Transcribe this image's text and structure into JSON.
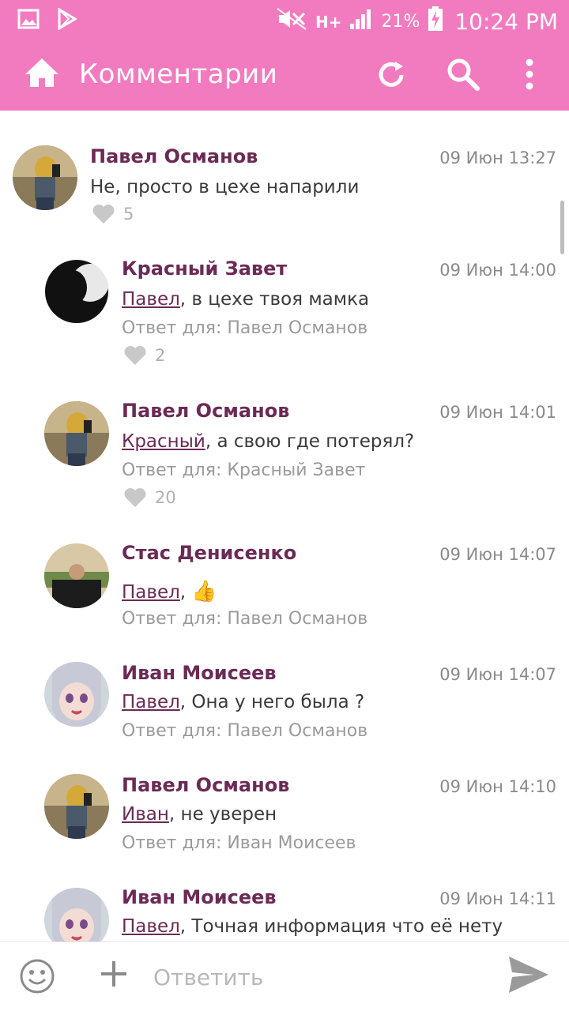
{
  "status_bar": {
    "network": "H+",
    "battery_percent": "21%",
    "time": "10:24 PM"
  },
  "app_bar": {
    "title": "Комментарии"
  },
  "comments": [
    {
      "author": "Павел Османов",
      "time": "09 Июн 13:27",
      "mention": "",
      "text": "Не, просто в цехе напарили",
      "reply_to": "",
      "likes": "5",
      "avatar": "selfie-mirror"
    },
    {
      "author": "Красный Завет",
      "time": "09 Июн 14:00",
      "mention": "Павел",
      "text": ", в цехе твоя мамка",
      "reply_to": "Ответ для: Павел Османов",
      "likes": "2",
      "avatar": "silhouette"
    },
    {
      "author": "Павел Османов",
      "time": "09 Июн 14:01",
      "mention": "Красный",
      "text": ", а свою где потерял?",
      "reply_to": "Ответ для: Красный Завет",
      "likes": "20",
      "avatar": "selfie-mirror"
    },
    {
      "author": "Стас Денисенко",
      "time": "09 Июн 14:07",
      "mention": "Павел",
      "text": ", ",
      "emoji": "👍",
      "reply_to": "Ответ для: Павел Османов",
      "likes": "",
      "avatar": "outdoor-man"
    },
    {
      "author": "Иван Моисеев",
      "time": "09 Июн 14:07",
      "mention": "Павел",
      "text": ",  Она у него была ?",
      "reply_to": "Ответ для: Павел Османов",
      "likes": "",
      "avatar": "anime-girl"
    },
    {
      "author": "Павел Османов",
      "time": "09 Июн 14:10",
      "mention": "Иван",
      "text": ", не уверен",
      "reply_to": "Ответ для: Иван Моисеев",
      "likes": "",
      "avatar": "selfie-mirror"
    },
    {
      "author": "Иван Моисеев",
      "time": "09 Июн 14:11",
      "mention": "Павел",
      "text": ",  Точная информация что её нету",
      "reply_to": "",
      "likes": "",
      "avatar": "anime-girl"
    }
  ],
  "composer": {
    "placeholder": "Ответить"
  },
  "colors": {
    "accent": "#f27bc0",
    "author": "#6b2a55"
  }
}
